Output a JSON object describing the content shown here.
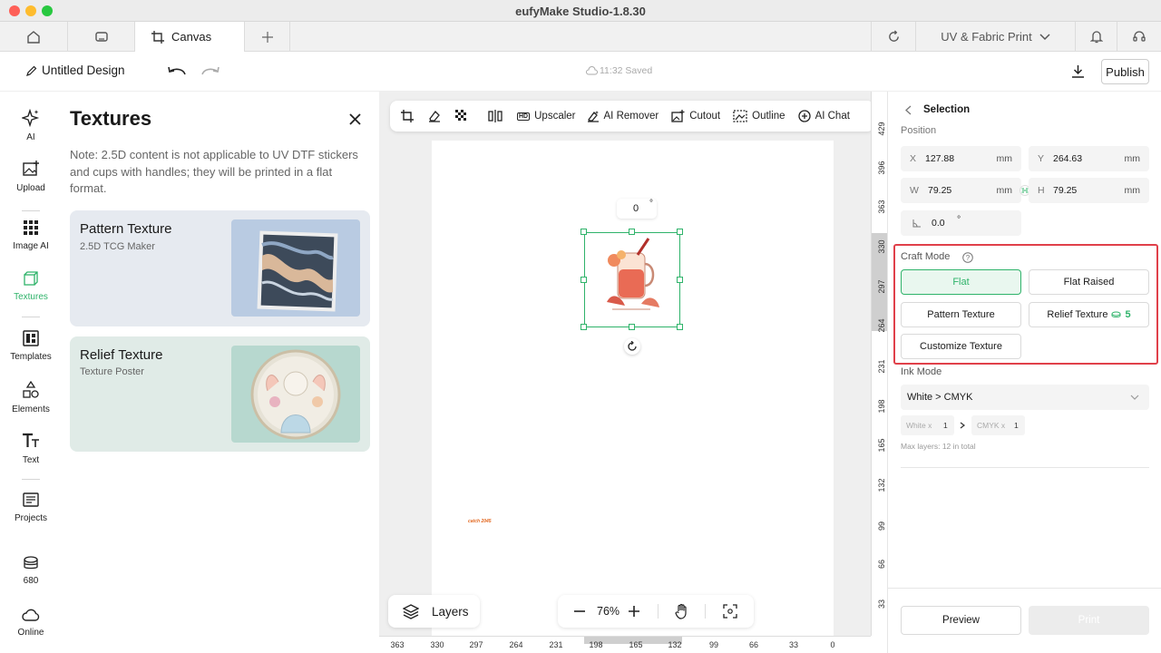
{
  "window": {
    "title": "eufyMake Studio-1.8.30"
  },
  "tabs": {
    "canvas_label": "Canvas",
    "mode_label": "UV & Fabric Print"
  },
  "header": {
    "design_name": "Untitled Design",
    "save_status": "11:32 Saved",
    "publish_label": "Publish"
  },
  "rail": {
    "items": [
      {
        "label": "AI",
        "icon": "sparkle-icon"
      },
      {
        "label": "Upload",
        "icon": "upload-image-icon"
      },
      {
        "label": "Image AI",
        "icon": "grid-icon"
      },
      {
        "label": "Textures",
        "icon": "cube-icon"
      },
      {
        "label": "Templates",
        "icon": "template-icon"
      },
      {
        "label": "Elements",
        "icon": "shapes-icon"
      },
      {
        "label": "Text",
        "icon": "text-icon"
      },
      {
        "label": "Projects",
        "icon": "folder-list-icon"
      },
      {
        "label": "680",
        "icon": "coins-icon"
      },
      {
        "label": "Online",
        "icon": "cloud-icon"
      }
    ],
    "active_color": "#2fb36a"
  },
  "textures": {
    "title": "Textures",
    "note": "Note: 2.5D content is not applicable to UV DTF stickers and cups with handles; they will be printed in a flat format.",
    "cards": [
      {
        "title": "Pattern Texture",
        "subtitle": "2.5D TCG Maker"
      },
      {
        "title": "Relief Texture",
        "subtitle": "Texture Poster"
      }
    ]
  },
  "toolbar": {
    "upscaler": "Upscaler",
    "ai_remover": "AI Remover",
    "cutout": "Cutout",
    "outline": "Outline",
    "ai_chat": "AI Chat",
    "hd_badge": "HD"
  },
  "canvas": {
    "rotation_value": "0",
    "rotation_unit": "°",
    "zoom": "76%",
    "layers_label": "Layers",
    "tiny_text": "catch 2045",
    "ruler_v": [
      "429",
      "396",
      "363",
      "330",
      "297",
      "264",
      "231",
      "198",
      "165",
      "132",
      "99",
      "66",
      "33"
    ],
    "ruler_h": [
      "363",
      "330",
      "297",
      "264",
      "231",
      "198",
      "165",
      "132",
      "99",
      "66",
      "33",
      "0"
    ]
  },
  "selection": {
    "title": "Selection",
    "position_label": "Position",
    "x_key": "X",
    "x_value": "127.88",
    "y_key": "Y",
    "y_value": "264.63",
    "w_key": "W",
    "w_value": "79.25",
    "h_key": "H",
    "h_value": "79.25",
    "unit": "mm",
    "angle_value": "0.0",
    "angle_unit": "°",
    "craft_mode_label": "Craft Mode",
    "craft_options": [
      "Flat",
      "Flat Raised",
      "Pattern Texture",
      "Relief Texture",
      "Customize Texture"
    ],
    "relief_badge": "5",
    "ink_mode_label": "Ink Mode",
    "ink_mode_value": "White > CMYK",
    "white_label": "White x",
    "white_count": "1",
    "cmyk_label": "CMYK x",
    "cmyk_count": "1",
    "max_layers": "Max layers: 12 in total",
    "preview_label": "Preview",
    "print_label": "Print"
  },
  "colors": {
    "accent": "#2fb36a",
    "highlight_border": "#e0404a"
  }
}
